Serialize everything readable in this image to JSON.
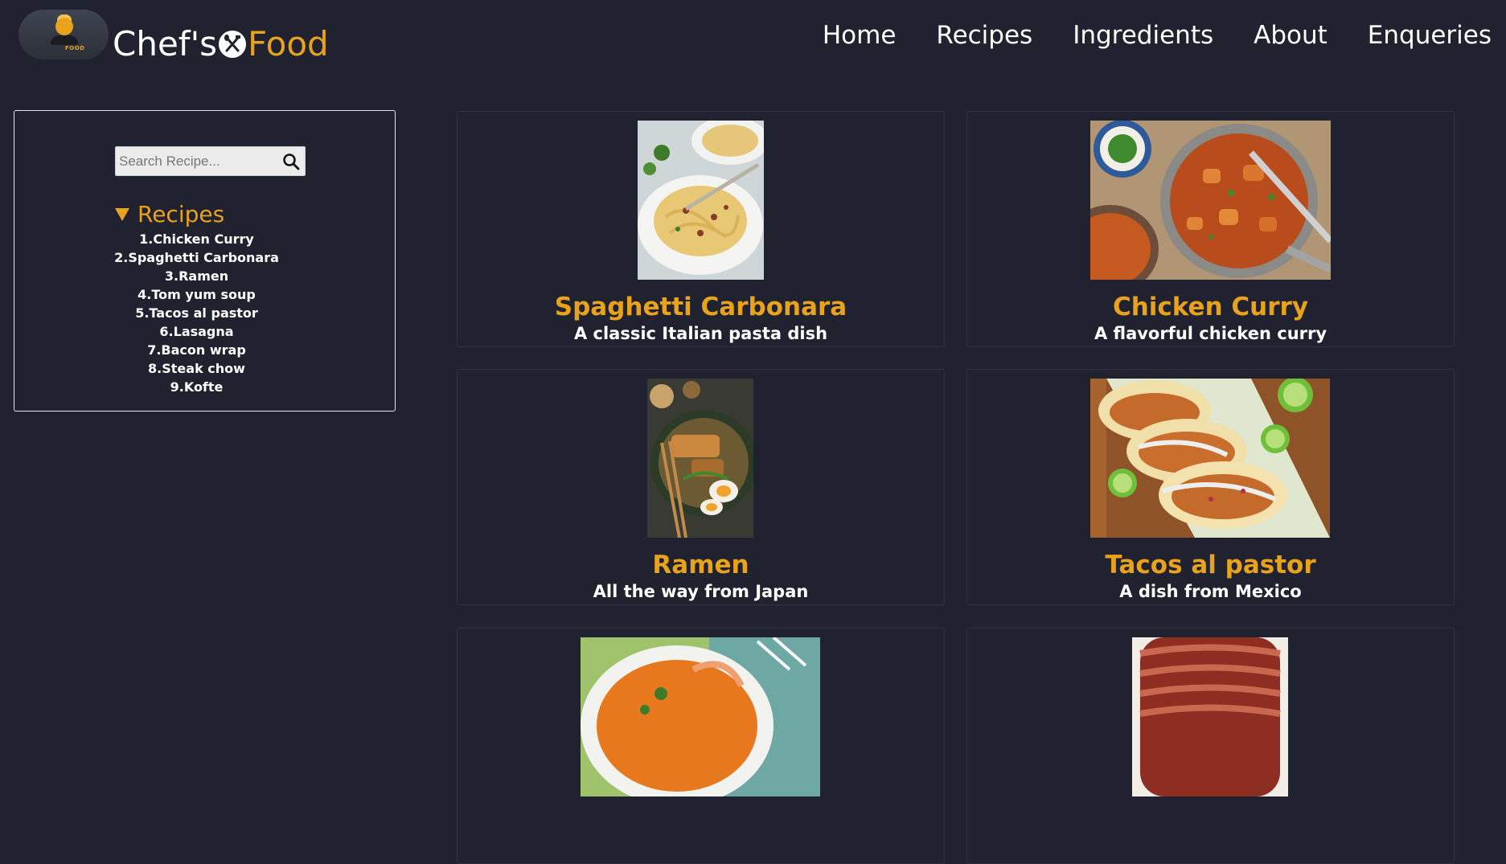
{
  "header": {
    "logo_badge_text": "FOOD",
    "brand_first": "Chef's",
    "brand_second": "Food",
    "nav": [
      "Home",
      "Recipes",
      "Ingredients",
      "About",
      "Enqueries"
    ]
  },
  "sidebar": {
    "search_placeholder": "Search Recipe...",
    "recipes_heading": "Recipes",
    "recipes": [
      "1.Chicken Curry",
      "2.Spaghetti Carbonara",
      "3.Ramen",
      "4.Tom yum soup",
      "5.Tacos al pastor",
      "6.Lasagna",
      "7.Bacon wrap",
      "8.Steak chow",
      "9.Kofte"
    ]
  },
  "cards": [
    {
      "title": "Spaghetti Carbonara",
      "description": "A classic Italian pasta dish",
      "image": "spaghetti-carbonara-photo"
    },
    {
      "title": "Chicken Curry",
      "description": "A flavorful chicken curry",
      "image": "chicken-curry-photo"
    },
    {
      "title": "Ramen",
      "description": "All the way from Japan",
      "image": "ramen-photo"
    },
    {
      "title": "Tacos al pastor",
      "description": "A dish from Mexico",
      "image": "tacos-photo"
    },
    {
      "title": "",
      "description": "",
      "image": "tom-yum-soup-photo"
    },
    {
      "title": "",
      "description": "",
      "image": "bacon-wrap-photo"
    }
  ],
  "colors": {
    "background": "#202230",
    "accent": "#e8a21c",
    "text": "#ffffff",
    "card_border": "#2f3240"
  }
}
